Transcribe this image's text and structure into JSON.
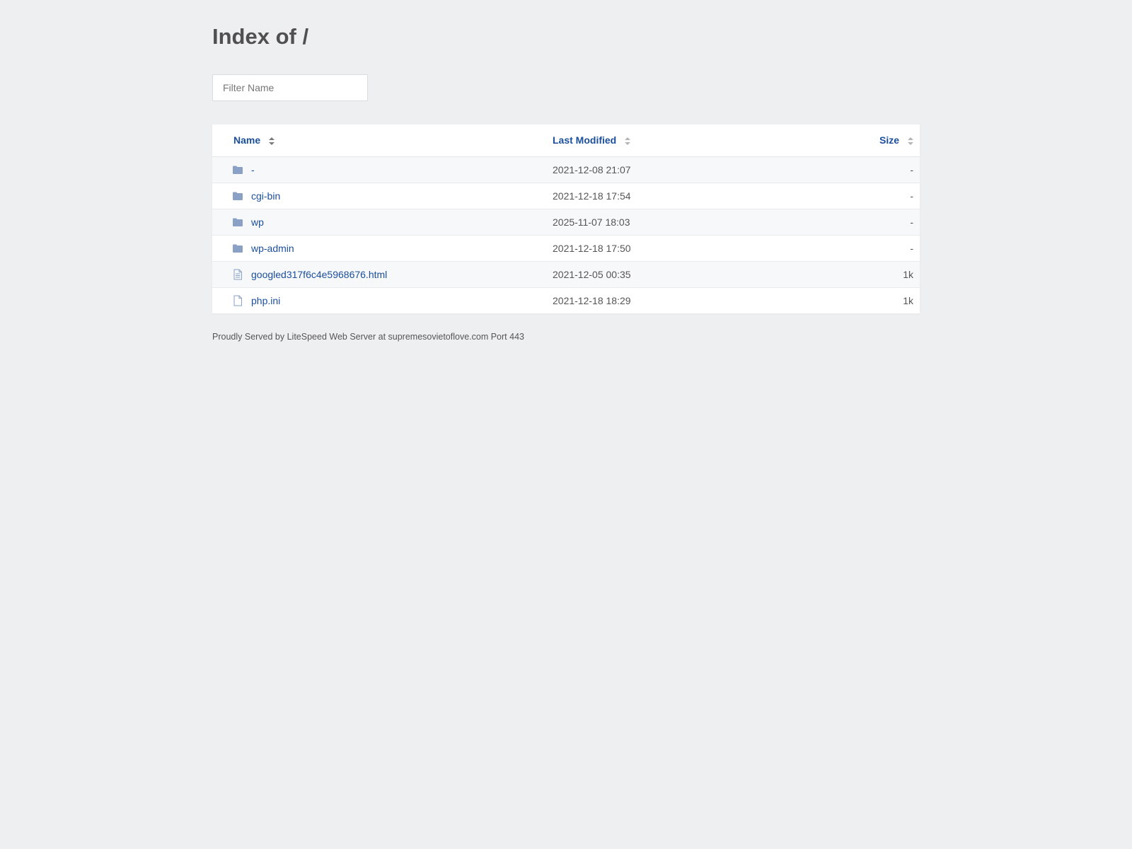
{
  "title": "Index of /",
  "filter": {
    "placeholder": "Filter Name",
    "value": ""
  },
  "columns": {
    "name": "Name",
    "modified": "Last Modified",
    "size": "Size"
  },
  "rows": [
    {
      "name": "-",
      "modified": "2021-12-08 21:07",
      "size": "-",
      "type": "folder",
      "icon": "folder-icon"
    },
    {
      "name": "cgi-bin",
      "modified": "2021-12-18 17:54",
      "size": "-",
      "type": "folder",
      "icon": "folder-icon"
    },
    {
      "name": "wp",
      "modified": "2025-11-07 18:03",
      "size": "-",
      "type": "folder",
      "icon": "folder-icon"
    },
    {
      "name": "wp-admin",
      "modified": "2021-12-18 17:50",
      "size": "-",
      "type": "folder",
      "icon": "folder-icon"
    },
    {
      "name": "googled317f6c4e5968676.html",
      "modified": "2021-12-05 00:35",
      "size": "1k",
      "type": "text-file",
      "icon": "text-file-icon"
    },
    {
      "name": "php.ini",
      "modified": "2021-12-18 18:29",
      "size": "1k",
      "type": "file",
      "icon": "file-icon"
    }
  ],
  "footer": "Proudly Served by LiteSpeed Web Server at supremesovietoflove.com Port 443",
  "colors": {
    "background": "#edeff1",
    "link": "#1b4f9c",
    "folder_icon": "#8aa0c4",
    "file_icon": "#8aa0c4"
  }
}
